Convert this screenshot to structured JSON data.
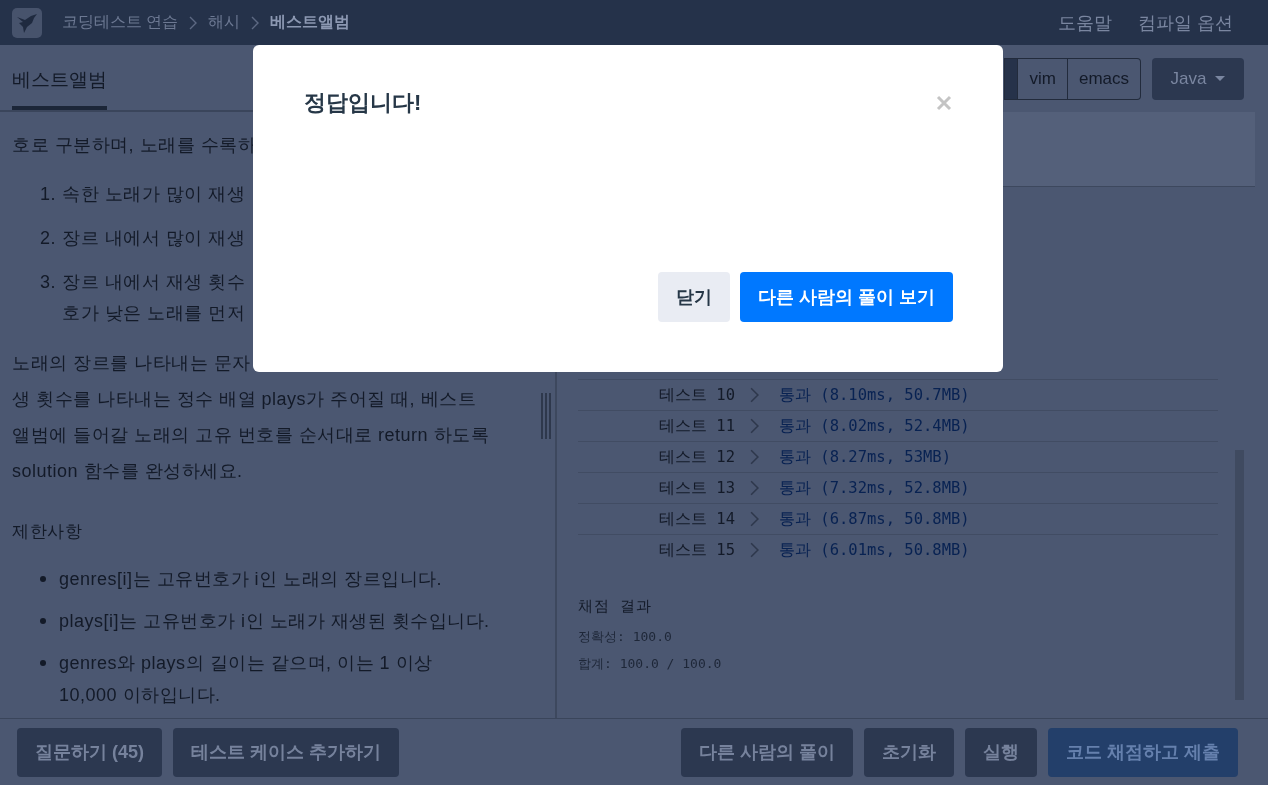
{
  "header": {
    "breadcrumbs": [
      {
        "label": "코딩테스트 연습",
        "current": false
      },
      {
        "label": "해시",
        "current": false
      },
      {
        "label": "베스트앨범",
        "current": true
      }
    ],
    "links": [
      "도움말",
      "컴파일 옵션"
    ]
  },
  "problem_tabs": [
    {
      "label": "베스트앨범",
      "selected": true
    }
  ],
  "problem": {
    "intro_line": "호로 구분하며, 노래를 수록하",
    "rules": [
      {
        "number": "1.",
        "lines": [
          "속한 노래가 많이 재생"
        ]
      },
      {
        "number": "2.",
        "lines": [
          "장르 내에서 많이 재생"
        ]
      },
      {
        "number": "3.",
        "lines": [
          "장르 내에서 재생 횟수",
          "호가 낮은 노래를 먼저"
        ]
      }
    ],
    "paragraph_lines": [
      "노래의 장르를 나타내는 문자",
      "생 횟수를 나타내는 정수 배열 plays가 주어질 때, 베스트",
      "앨범에 들어갈 노래의 고유 번호를 순서대로 return 하도록",
      "solution 함수를 완성하세요."
    ],
    "constraints_title": "제한사항",
    "constraints": [
      "genres[i]는 고유번호가 i인 노래의 장르입니다.",
      "plays[i]는 고유번호가 i인 노래가 재생된 횟수입니다.",
      "genres와 plays의 길이는 같으며, 이는 1 이상 10,000 이하입니다."
    ]
  },
  "editor_toolbar": {
    "keymaps": [
      {
        "selected": true
      },
      {
        "label": "vim",
        "selected": false
      },
      {
        "label": "emacs",
        "selected": false
      }
    ],
    "language": "Java"
  },
  "results": {
    "rows": [
      {
        "name": "테스트 10",
        "result": "통과 (8.10ms, 50.7MB)"
      },
      {
        "name": "테스트 11",
        "result": "통과 (8.02ms, 52.4MB)"
      },
      {
        "name": "테스트 12",
        "result": "통과 (8.27ms, 53MB)"
      },
      {
        "name": "테스트 13",
        "result": "통과 (7.32ms, 52.8MB)"
      },
      {
        "name": "테스트 14",
        "result": "통과 (6.87ms, 50.8MB)"
      },
      {
        "name": "테스트 15",
        "result": "통과 (6.01ms, 50.8MB)"
      }
    ],
    "summary_title": "채점 결과",
    "summary_lines": [
      "정확성: 100.0",
      "합계: 100.0 / 100.0"
    ]
  },
  "footer": {
    "left_buttons": [
      {
        "label": "질문하기 (45)",
        "kind": "secondary"
      },
      {
        "label": "테스트 케이스 추가하기",
        "kind": "secondary"
      }
    ],
    "right_buttons": [
      {
        "label": "다른 사람의 풀이",
        "kind": "secondary"
      },
      {
        "label": "초기화",
        "kind": "secondary"
      },
      {
        "label": "실행",
        "kind": "secondary"
      },
      {
        "label": "코드 채점하고 제출",
        "kind": "primary"
      }
    ]
  },
  "dialog": {
    "title": "정답입니다!",
    "buttons": [
      {
        "label": "닫기",
        "kind": "secondary"
      },
      {
        "label": "다른 사람의 풀이 보기",
        "kind": "primary"
      }
    ]
  }
}
